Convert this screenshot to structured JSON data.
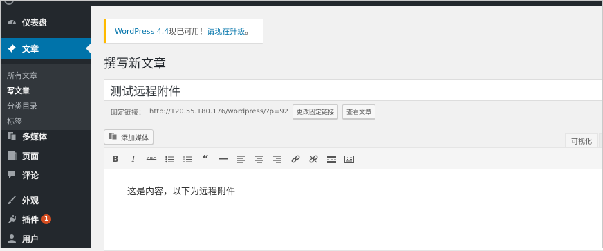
{
  "sidebar": {
    "items": [
      {
        "key": "dashboard",
        "label": "仪表盘",
        "icon": "dashboard-icon"
      },
      {
        "key": "posts",
        "label": "文章",
        "icon": "pushpin-icon"
      },
      {
        "key": "media",
        "label": "多媒体",
        "icon": "media-icon"
      },
      {
        "key": "pages",
        "label": "页面",
        "icon": "page-icon"
      },
      {
        "key": "comments",
        "label": "评论",
        "icon": "comment-icon"
      },
      {
        "key": "appearance",
        "label": "外观",
        "icon": "paintbrush-icon"
      },
      {
        "key": "plugins",
        "label": "插件",
        "icon": "plugin-icon",
        "badge": "1"
      },
      {
        "key": "users",
        "label": "用户",
        "icon": "user-icon"
      }
    ],
    "submenu": [
      {
        "label": "所有文章"
      },
      {
        "label": "写文章"
      },
      {
        "label": "分类目录"
      },
      {
        "label": "标签"
      }
    ]
  },
  "notice": {
    "link1": "WordPress 4.4",
    "text1": "现已可用！",
    "link2": "请现在升级",
    "text2": "。"
  },
  "page": {
    "title": "撰写新文章"
  },
  "post": {
    "title_value": "测试远程附件",
    "permalink_label": "固定链接：",
    "permalink_url": "http://120.55.180.176/wordpress/?p=92",
    "edit_permalink": "更改固定链接",
    "view_post": "查看文章",
    "add_media": "添加媒体",
    "tab_visual": "可视化",
    "content": "这是内容，以下为远程附件"
  },
  "colors": {
    "admin_dark": "#23282d",
    "accent": "#0073aa",
    "submenu_bg": "#32373c",
    "notice_border": "#ffba00",
    "badge": "#d54e21"
  }
}
